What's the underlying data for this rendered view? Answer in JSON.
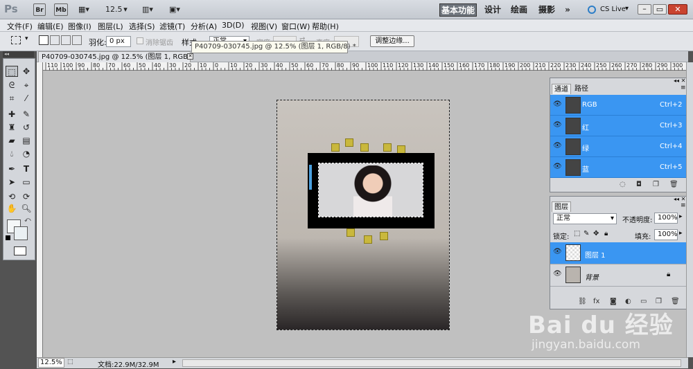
{
  "titlebar": {
    "app_logo": "Ps",
    "br": "Br",
    "mb": "Mb",
    "zoom": "12.5",
    "workspaces": [
      "基本功能",
      "设计",
      "绘画",
      "摄影"
    ],
    "more": "»",
    "cslive": "CS Live"
  },
  "menu": [
    "文件(F)",
    "编辑(E)",
    "图像(I)",
    "图层(L)",
    "选择(S)",
    "滤镜(T)",
    "分析(A)",
    "3D(D)",
    "视图(V)",
    "窗口(W)",
    "帮助(H)"
  ],
  "options": {
    "feather_label": "羽化:",
    "feather_value": "0 px",
    "antialias": "消除锯齿",
    "style_label": "样式:",
    "style_value": "正常",
    "width_label": "宽度:",
    "height_label": "高度:",
    "refine": "调整边缘..."
  },
  "document": {
    "tab": "P40709-030745.jpg @ 12.5% (图层 1, RGB/8) *",
    "tooltip": "P40709-030745.jpg @ 12.5% (图层 1, RGB/8) *",
    "ruler_ticks": [
      "110",
      "100",
      "90",
      "80",
      "70",
      "60",
      "50",
      "40",
      "30",
      "20",
      "10",
      "0",
      "10",
      "20",
      "30",
      "40",
      "50",
      "60",
      "70",
      "80",
      "90",
      "100",
      "110",
      "120",
      "130",
      "140",
      "150",
      "160",
      "170",
      "180",
      "190",
      "200",
      "210",
      "220",
      "230",
      "240",
      "250",
      "260",
      "270",
      "280",
      "290",
      "300"
    ]
  },
  "status": {
    "zoom": "12.5%",
    "doc": "文档:22.9M/32.9M"
  },
  "channels": {
    "tabs": [
      "通道",
      "路径"
    ],
    "rows": [
      {
        "name": "RGB",
        "shortcut": "Ctrl+2"
      },
      {
        "name": "红",
        "shortcut": "Ctrl+3"
      },
      {
        "name": "绿",
        "shortcut": "Ctrl+4"
      },
      {
        "name": "蓝",
        "shortcut": "Ctrl+5"
      }
    ]
  },
  "layers": {
    "tab": "图层",
    "blend": "正常",
    "opacity_label": "不透明度:",
    "opacity": "100%",
    "lock_label": "锁定:",
    "fill_label": "填充:",
    "fill": "100%",
    "rows": [
      {
        "name": "图层 1",
        "selected": true
      },
      {
        "name": "背景",
        "selected": false
      }
    ]
  },
  "watermark": {
    "text": "Bai du 经验",
    "url": "jingyan.baidu.com"
  },
  "colors": {
    "accent": "#3a96f2",
    "canvas_bg": "#c0c0c0"
  }
}
